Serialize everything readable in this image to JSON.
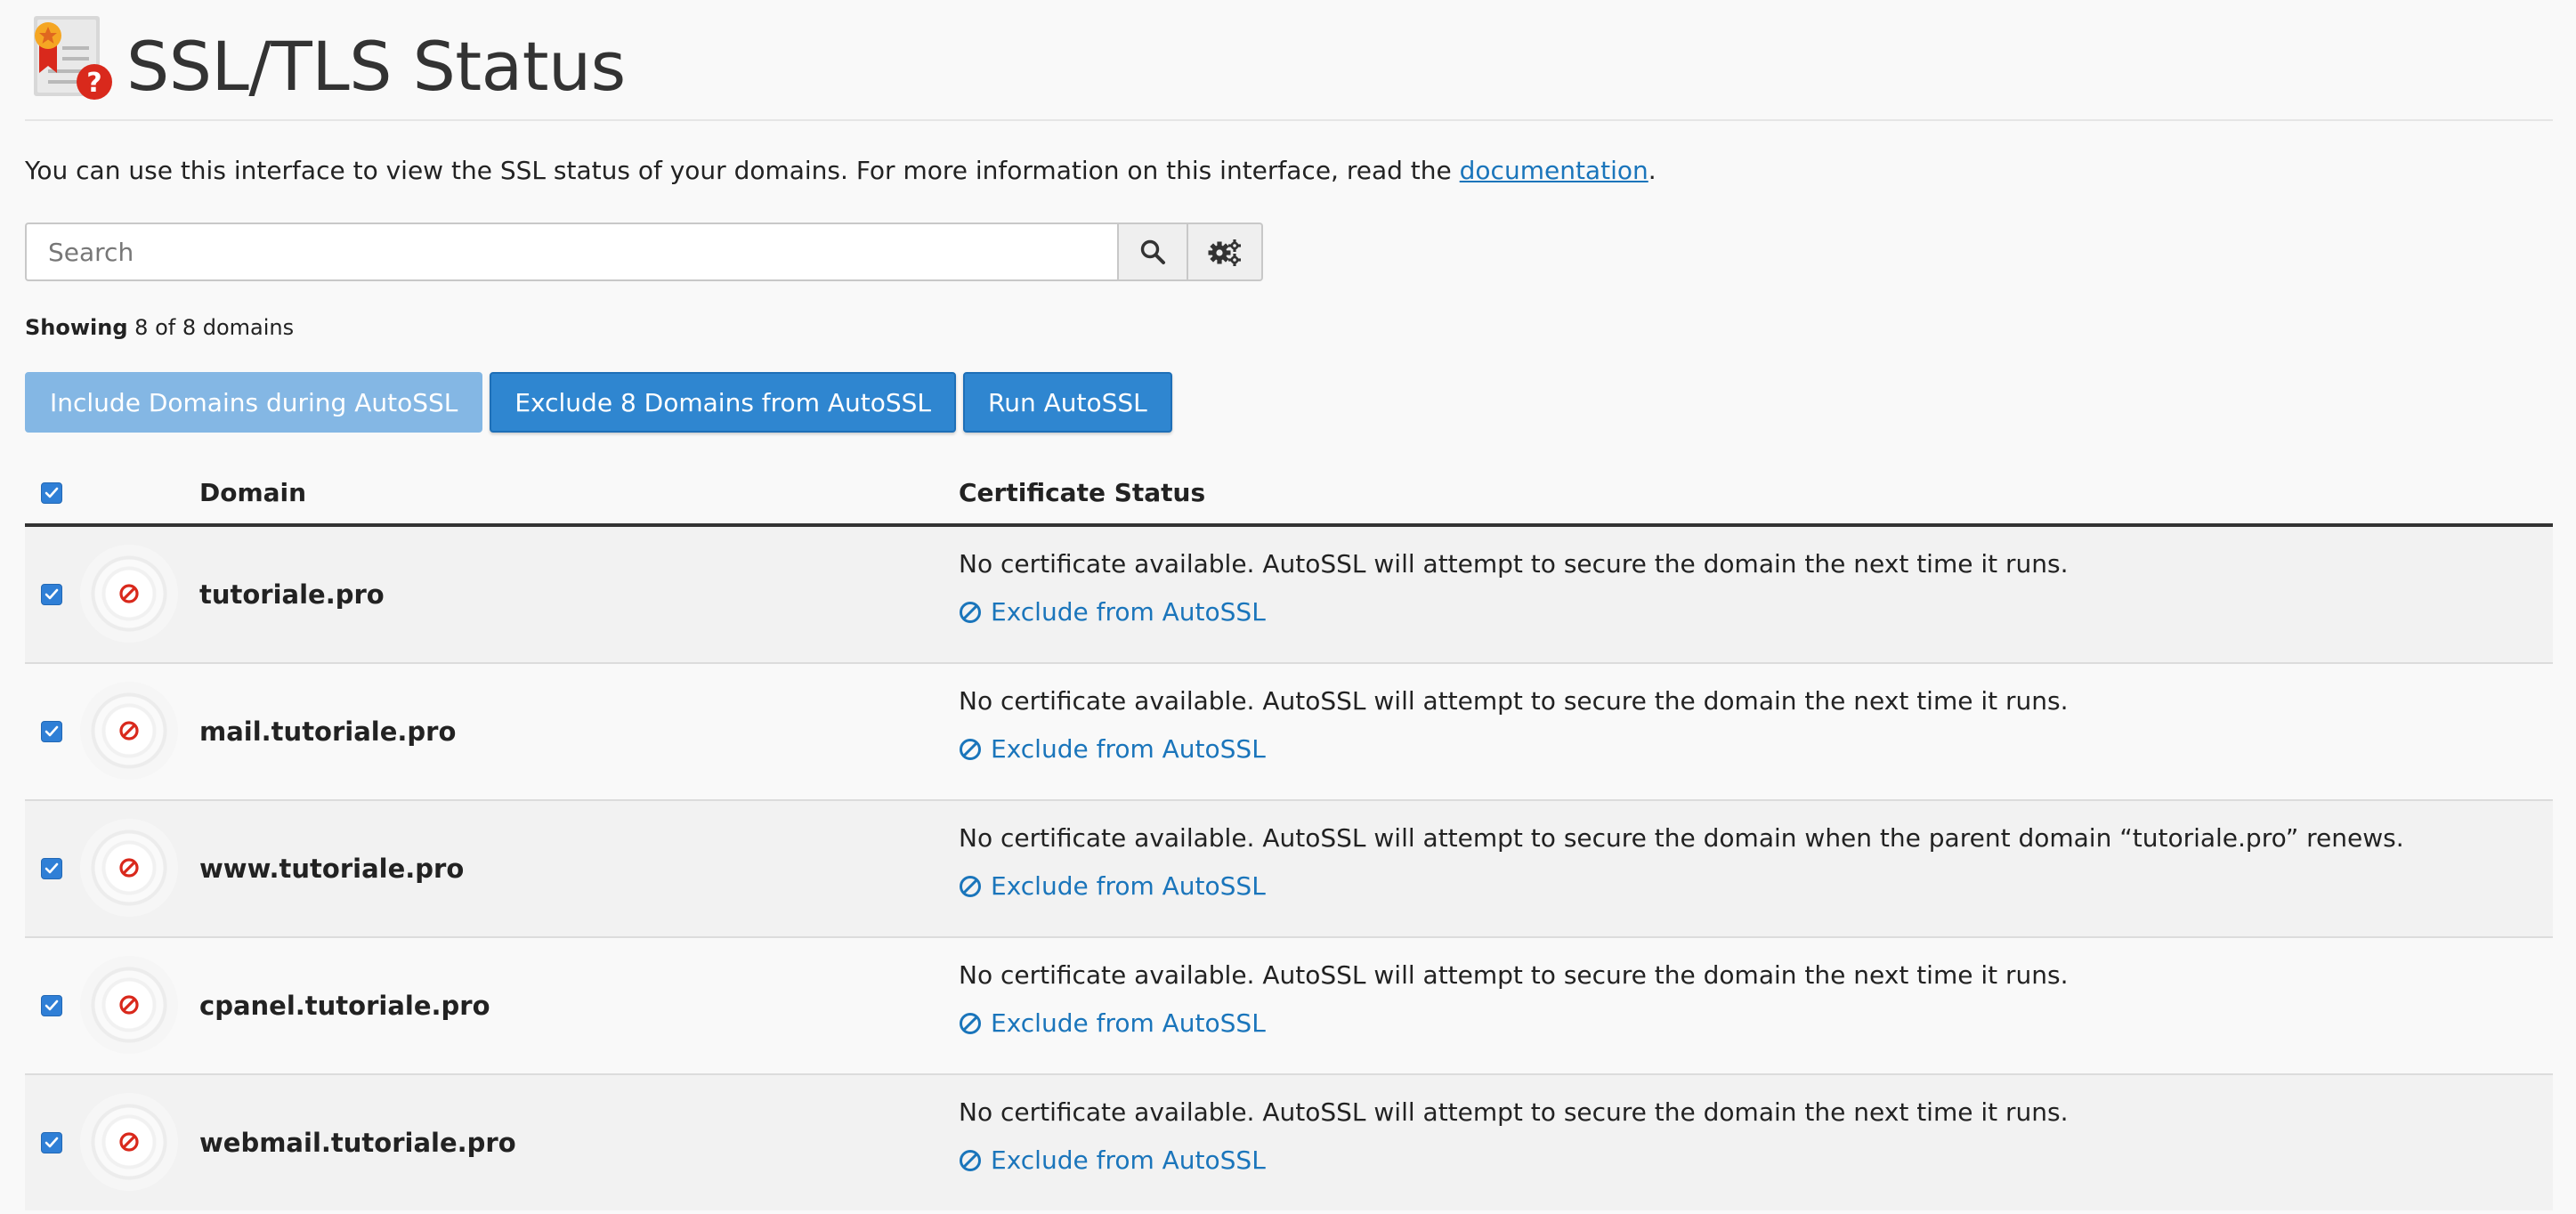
{
  "header": {
    "title": "SSL/TLS Status",
    "icon": "certificate-question-icon"
  },
  "intro": {
    "text": "You can use this interface to view the SSL status of your domains. For more information on this interface, read the ",
    "link_label": "documentation",
    "suffix": "."
  },
  "search": {
    "placeholder": "Search",
    "value": "",
    "search_icon": "search-icon",
    "settings_icon": "gears-icon"
  },
  "showing": {
    "label": "Showing",
    "text": "8 of 8 domains"
  },
  "actions": {
    "include_label": "Include Domains during AutoSSL",
    "exclude_label": "Exclude 8 Domains from AutoSSL",
    "run_label": "Run AutoSSL"
  },
  "table": {
    "columns": {
      "domain": "Domain",
      "status": "Certificate Status"
    },
    "rows": [
      {
        "domain": "tutoriale.pro",
        "status": "No certificate available. AutoSSL will attempt to secure the domain the next time it runs.",
        "action": "Exclude from AutoSSL",
        "checked": true
      },
      {
        "domain": "mail.tutoriale.pro",
        "status": "No certificate available. AutoSSL will attempt to secure the domain the next time it runs.",
        "action": "Exclude from AutoSSL",
        "checked": true
      },
      {
        "domain": "www.tutoriale.pro",
        "status": "No certificate available. AutoSSL will attempt to secure the domain when the parent domain “tutoriale.pro” renews.",
        "action": "Exclude from AutoSSL",
        "checked": true
      },
      {
        "domain": "cpanel.tutoriale.pro",
        "status": "No certificate available. AutoSSL will attempt to secure the domain the next time it runs.",
        "action": "Exclude from AutoSSL",
        "checked": true
      },
      {
        "domain": "webmail.tutoriale.pro",
        "status": "No certificate available. AutoSSL will attempt to secure the domain the next time it runs.",
        "action": "Exclude from AutoSSL",
        "checked": true
      }
    ]
  },
  "colors": {
    "primary": "#2f86d0",
    "primary_disabled": "#84b7e4",
    "link": "#1a75bb",
    "error": "#d9291c",
    "checkbox": "#2f7fd6"
  }
}
